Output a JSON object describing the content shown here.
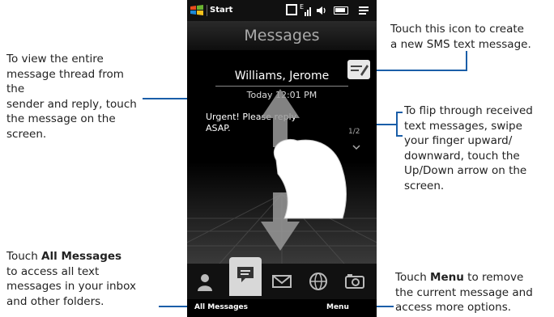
{
  "callouts": {
    "left_top": [
      "To view the entire",
      "message thread from the",
      "sender and reply, touch",
      "the message on the",
      "screen."
    ],
    "left_bottom_pre": "Touch ",
    "left_bottom_bold": "All Messages",
    "left_bottom_lines": [
      "to access all text",
      "messages in your inbox",
      "and other folders."
    ],
    "right_top": [
      "Touch this icon to create",
      "a new SMS text message."
    ],
    "right_middle": [
      "To flip through received",
      "text messages, swipe",
      "your finger upward/",
      "downward, touch the",
      "Up/Down arrow on the",
      "screen."
    ],
    "right_bottom_pre": "Touch ",
    "right_bottom_bold": "Menu",
    "right_bottom_first_rest": " to remove",
    "right_bottom_lines": [
      "the current message and",
      "access more options."
    ]
  },
  "phone": {
    "status": {
      "start": "Start",
      "network": "E"
    },
    "title": "Messages",
    "message": {
      "sender": "Williams, Jerome",
      "time": "Today 12:01 PM",
      "body_line1": "Urgent! Please reply",
      "body_line2": "ASAP.",
      "counter": "1/2"
    },
    "softkeys": {
      "left": "All Messages",
      "right": "Menu"
    },
    "nav_icons": [
      "people-icon",
      "messages-icon",
      "email-icon",
      "internet-icon",
      "photos-icon"
    ]
  },
  "colors": {
    "leader_line": "#1a5ea8",
    "phone_bg": "#000000",
    "selected_tab": "#d8d8d8"
  }
}
